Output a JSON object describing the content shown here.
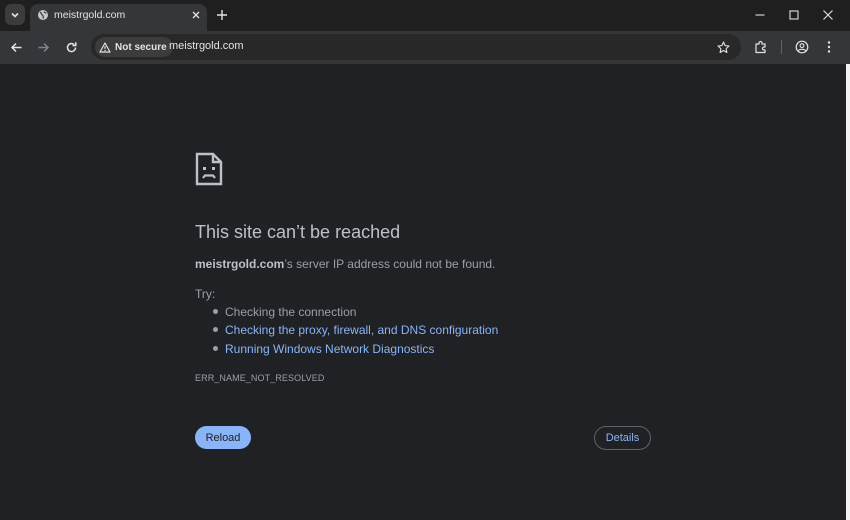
{
  "browser": {
    "tab": {
      "title": "meistrgold.com",
      "favicon": "globe-icon"
    },
    "address_bar": {
      "security_chip": "Not secure",
      "url": "meistrgold.com"
    },
    "icons": {
      "tab_search": "chevron-down-icon",
      "tab_close": "close-icon",
      "new_tab": "plus-icon",
      "minimize": "minimize-icon",
      "maximize": "maximize-icon",
      "close_window": "close-icon",
      "back": "back-arrow-icon",
      "forward": "forward-arrow-icon",
      "reload": "reload-icon",
      "warning": "warning-icon",
      "bookmark": "star-icon",
      "extensions": "puzzle-icon",
      "profile": "profile-icon",
      "menu": "kebab-menu-icon"
    }
  },
  "error_page": {
    "icon": "sad-page-icon",
    "heading": "This site can’t be reached",
    "host": "meistrgold.com",
    "message_suffix": "’s server IP address could not be found.",
    "try_label": "Try:",
    "suggestions": [
      {
        "text": "Checking the connection",
        "link": false
      },
      {
        "text": "Checking the proxy, firewall, and DNS configuration",
        "link": true
      },
      {
        "text": "Running Windows Network Diagnostics",
        "link": true
      }
    ],
    "error_code": "ERR_NAME_NOT_RESOLVED",
    "reload_label": "Reload",
    "details_label": "Details"
  },
  "colors": {
    "accent": "#8ab4f8",
    "content_bg": "#202124",
    "toolbar_bg": "#35363a",
    "text": "#bdc1c6"
  }
}
